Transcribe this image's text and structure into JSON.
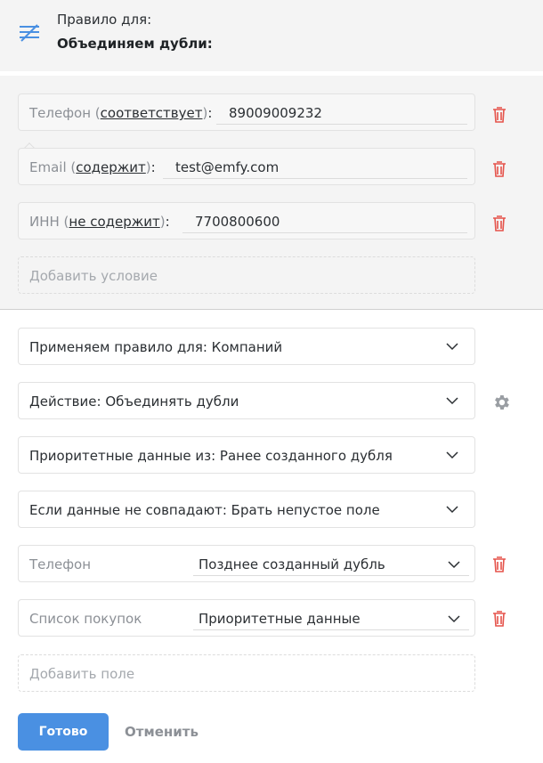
{
  "header": {
    "title": "Правило для:",
    "rule_name": "Объединяем дубли:"
  },
  "conditions": [
    {
      "field": "Телефон",
      "operator": "соответствует",
      "value": "89009009232"
    },
    {
      "field": "Email",
      "operator": "содержит",
      "value": "test@emfy.com"
    },
    {
      "field": "ИНН",
      "operator": "не содержит",
      "value": "7700800600"
    }
  ],
  "add_condition_label": "Добавить условие",
  "settings": {
    "apply_for": "Применяем правило для: Компаний",
    "action": "Действие: Объединять дубли",
    "priority": "Приоритетные данные из: Ранее созданного дубля",
    "mismatch": "Если данные не совпадают: Брать непустое поле"
  },
  "fields": [
    {
      "name": "Телефон",
      "choice": "Позднее созданный дубль"
    },
    {
      "name": "Список покупок",
      "choice": "Приоритетные данные"
    }
  ],
  "add_field_label": "Добавить поле",
  "buttons": {
    "done": "Готово",
    "cancel": "Отменить"
  },
  "colors": {
    "accent": "#4a90e2",
    "danger": "#e5534b",
    "background": "#f4f4f4"
  },
  "icons": {
    "header": "rule-list-icon",
    "delete": "trash-icon",
    "settings": "gear-icon",
    "dropdown": "chevron-down-icon"
  }
}
